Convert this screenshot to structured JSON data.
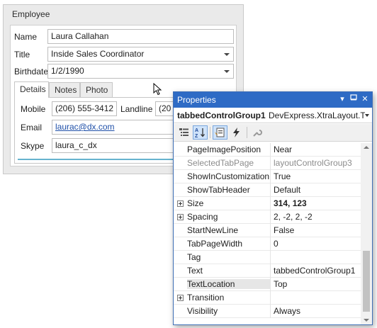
{
  "employee_form": {
    "title": "Employee",
    "fields": {
      "name": {
        "label": "Name",
        "value": "Laura Callahan"
      },
      "title": {
        "label": "Title",
        "value": "Inside Sales Coordinator"
      },
      "birthdate": {
        "label": "Birthdate",
        "value": "1/2/1990"
      }
    },
    "tabs": [
      "Details",
      "Notes",
      "Photo"
    ],
    "details": {
      "mobile": {
        "label": "Mobile",
        "value": "(206) 555-3412"
      },
      "landline": {
        "label": "Landline",
        "value": "(20"
      },
      "email": {
        "label": "Email",
        "value": "laurac@dx.com"
      },
      "skype": {
        "label": "Skype",
        "value": "laura_c_dx"
      }
    }
  },
  "properties_window": {
    "title": "Properties",
    "title_buttons": {
      "dropdown": "▾",
      "pin": "⊓",
      "close": "✕"
    },
    "object_name": "tabbedControlGroup1",
    "object_type": "DevExpress.XtraLayout.Ta",
    "toolbar": {
      "categorized": "categorized-icon",
      "alphabetical": "alphabetical-sort-icon",
      "properties": "properties-icon",
      "events": "lightning-events-icon",
      "settings": "wrench-icon"
    },
    "rows": [
      {
        "name": "PageImagePosition",
        "value": "Near"
      },
      {
        "name": "SelectedTabPage",
        "value": "layoutControlGroup3",
        "disabled": true
      },
      {
        "name": "ShowInCustomization",
        "value": "True"
      },
      {
        "name": "ShowTabHeader",
        "value": "Default"
      },
      {
        "name": "Size",
        "value": "314, 123",
        "expandable": true,
        "bold": true
      },
      {
        "name": "Spacing",
        "value": "2, -2, 2, -2",
        "expandable": true
      },
      {
        "name": "StartNewLine",
        "value": "False"
      },
      {
        "name": "TabPageWidth",
        "value": "0"
      },
      {
        "name": "Tag",
        "value": ""
      },
      {
        "name": "Text",
        "value": "tabbedControlGroup1"
      },
      {
        "name": "TextLocation",
        "value": "Top",
        "selected": true
      },
      {
        "name": "Transition",
        "value": "",
        "expandable": true
      },
      {
        "name": "Visibility",
        "value": "Always"
      }
    ]
  },
  "colors": {
    "titlebar": "#2e6bc5",
    "accent_underline": "#66b3cf",
    "link": "#1e4fa8"
  }
}
